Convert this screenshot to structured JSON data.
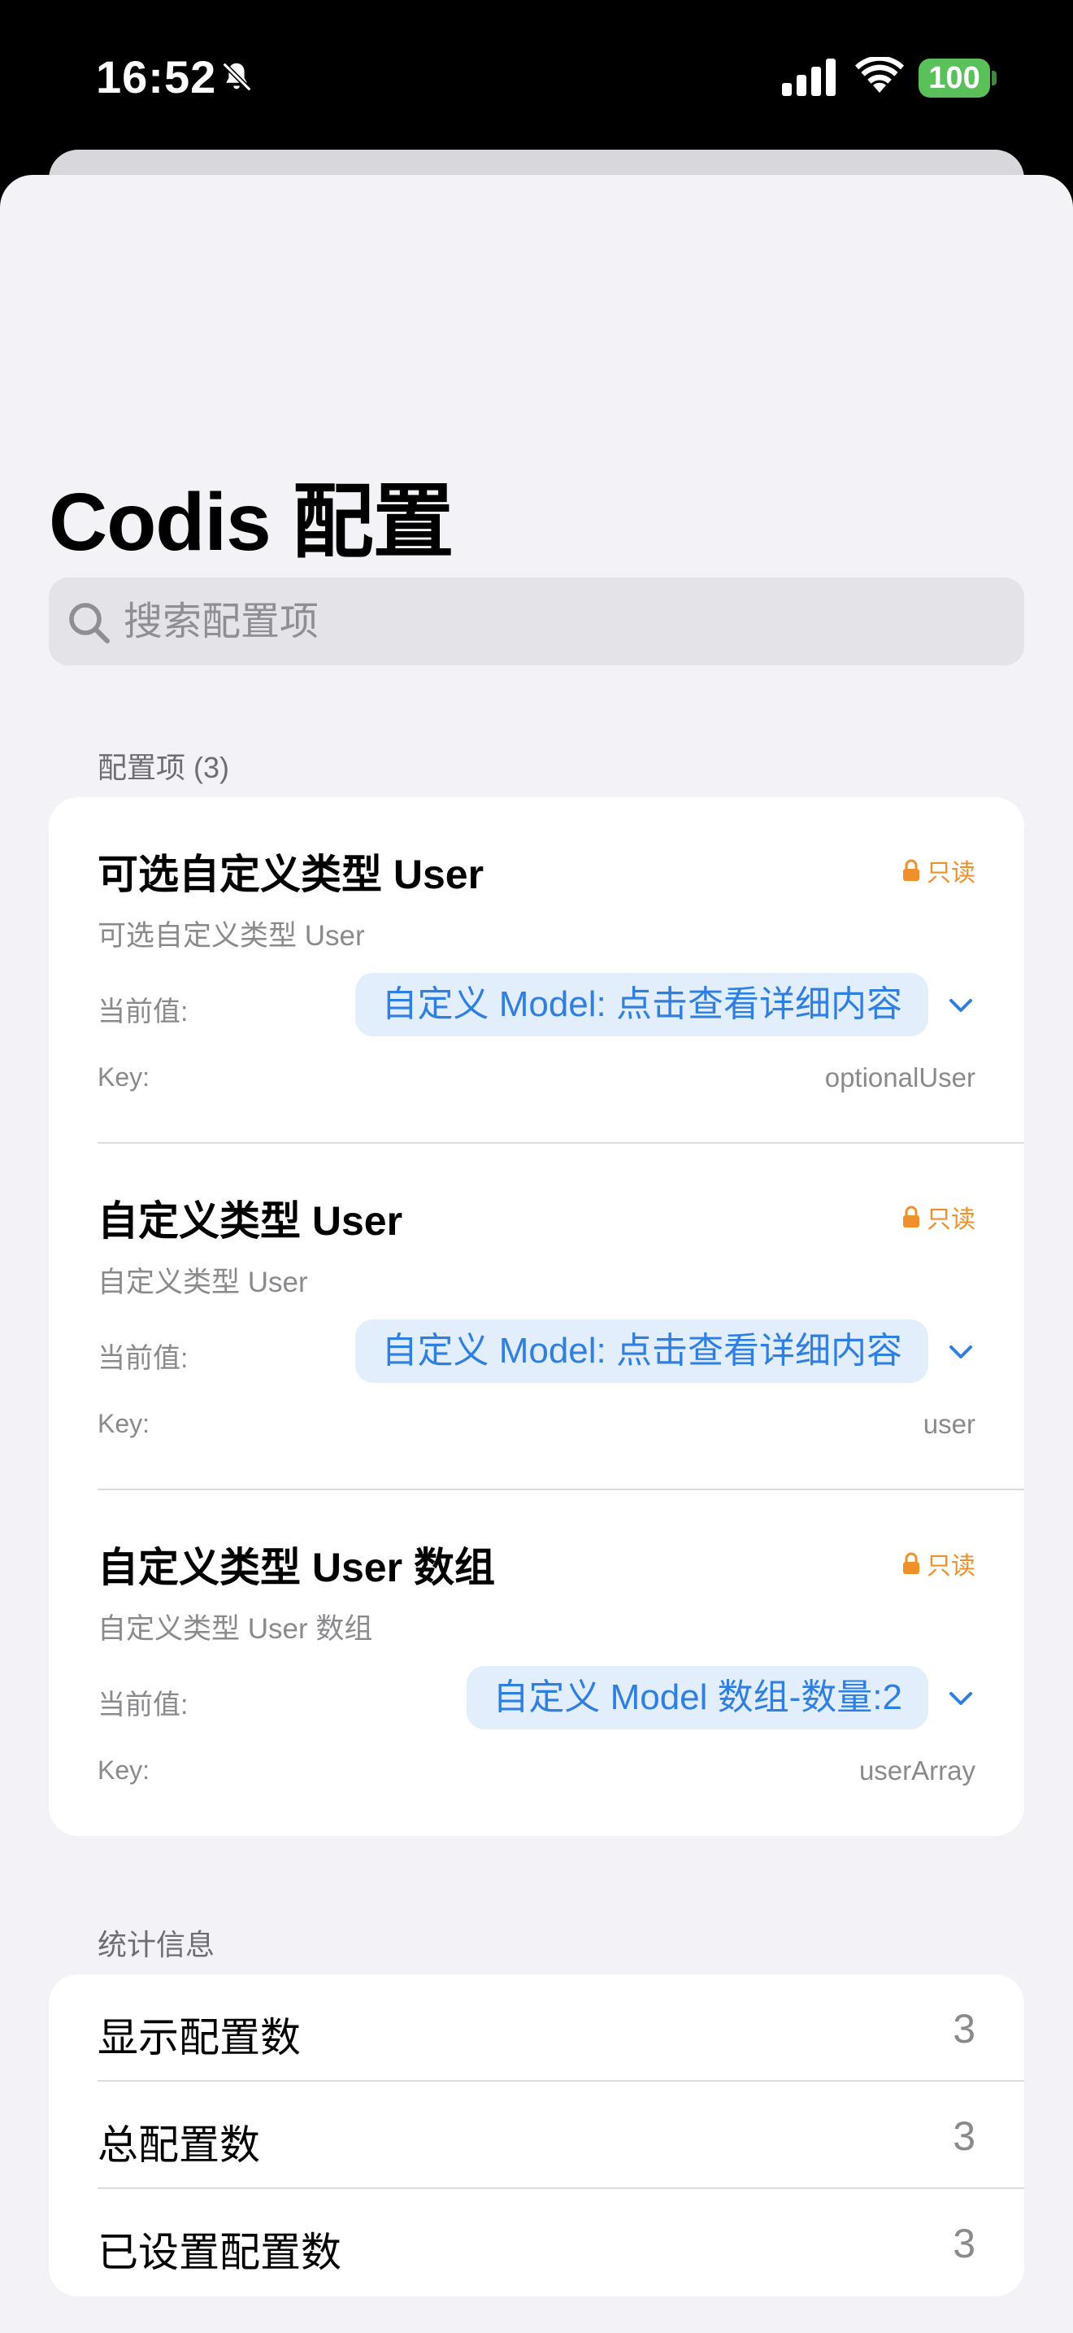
{
  "status_bar": {
    "time": "16:52",
    "battery": "100"
  },
  "page": {
    "title": "Codis 配置"
  },
  "search": {
    "placeholder": "搜索配置项",
    "value": ""
  },
  "config_section": {
    "header": "配置项 (3)",
    "items": [
      {
        "title": "可选自定义类型 User",
        "subtitle": "可选自定义类型 User",
        "badge": "只读",
        "current_label": "当前值:",
        "value": "自定义 Model: 点击查看详细内容",
        "key_label": "Key:",
        "key": "optionalUser"
      },
      {
        "title": "自定义类型 User",
        "subtitle": "自定义类型 User",
        "badge": "只读",
        "current_label": "当前值:",
        "value": "自定义 Model: 点击查看详细内容",
        "key_label": "Key:",
        "key": "user"
      },
      {
        "title": "自定义类型 User 数组",
        "subtitle": "自定义类型 User 数组",
        "badge": "只读",
        "current_label": "当前值:",
        "value": "自定义 Model 数组-数量:2",
        "key_label": "Key:",
        "key": "userArray"
      }
    ]
  },
  "stats_section": {
    "header": "统计信息",
    "rows": [
      {
        "label": "显示配置数",
        "value": "3"
      },
      {
        "label": "总配置数",
        "value": "3"
      },
      {
        "label": "已设置配置数",
        "value": "3"
      }
    ]
  },
  "colors": {
    "accent": "#2f7fe0",
    "pill_bg": "#e2eefb",
    "readonly": "#f0902a",
    "battery": "#5ac15a",
    "background": "#f2f2f7"
  }
}
